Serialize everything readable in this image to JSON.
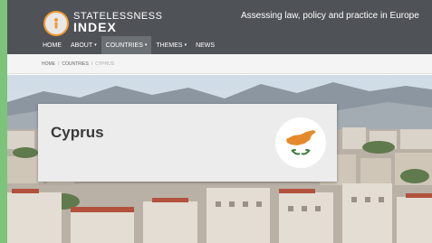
{
  "header": {
    "brand_top": "STATELESSNESS",
    "brand_bottom": "INDEX",
    "tagline": "Assessing law, policy and practice in Europe"
  },
  "nav": {
    "items": [
      {
        "label": "HOME",
        "caret": ""
      },
      {
        "label": "ABOUT",
        "caret": "▾"
      },
      {
        "label": "COUNTRIES",
        "caret": "▾"
      },
      {
        "label": "THEMES",
        "caret": "▾"
      },
      {
        "label": "NEWS",
        "caret": ""
      }
    ],
    "active": "COUNTRIES"
  },
  "breadcrumb": {
    "items": [
      "HOME",
      "COUNTRIES",
      "CYPRUS"
    ]
  },
  "card": {
    "title": "Cyprus",
    "flag_icon": "cyprus-flag-icon"
  },
  "colors": {
    "header_bg": "#4f5358",
    "accent_orange": "#f39a2e",
    "outer_bg": "#7cc47a",
    "flag_copper": "#e58a2c",
    "flag_olive": "#3e7a3a"
  }
}
